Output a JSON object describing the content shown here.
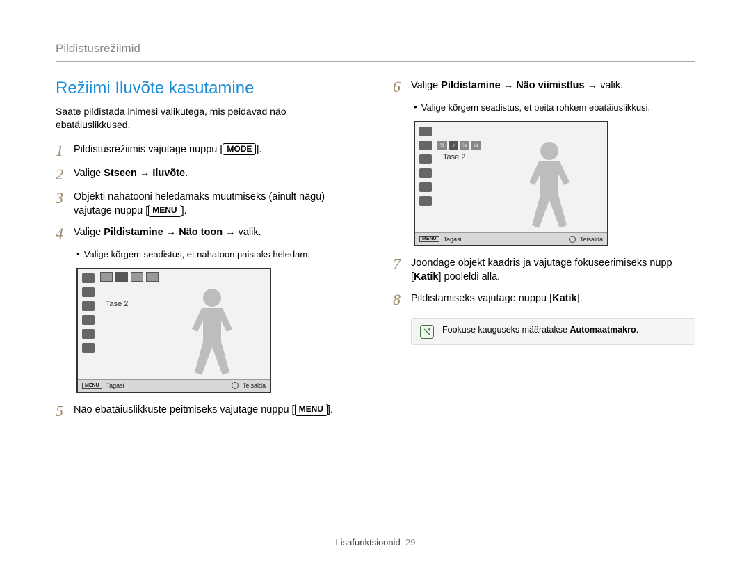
{
  "header": {
    "section": "Pildistusrežiimid"
  },
  "title": "Režiimi Iluvõte kasutamine",
  "intro": "Saate pildistada inimesi valikutega, mis peidavad näo ebatäiuslikkused.",
  "buttons": {
    "mode": "MODE",
    "menu": "MENU"
  },
  "steps_left": {
    "1": {
      "pre": "Pildistusrežiimis vajutage nuppu [",
      "btn": "mode",
      "post": "]."
    },
    "2": {
      "text_a": "Valige ",
      "bold": "Stseen → Iluvõte",
      "text_b": "."
    },
    "3": {
      "text_a": "Objekti nahatooni heledamaks muutmiseks (ainult nägu) vajutage nuppu [",
      "btn": "menu",
      "text_b": "]."
    },
    "4": {
      "text_a": "Valige ",
      "bold": "Pildistamine → Näo toon",
      "text_b": " → valik."
    },
    "4_bullet": "Valige kõrgem seadistus, et nahatoon paistaks heledam.",
    "5": {
      "text_a": "Näo ebatäiuslikkuste peitmiseks vajutage nuppu [",
      "btn": "menu",
      "text_b": "]."
    }
  },
  "steps_right": {
    "6": {
      "text_a": "Valige ",
      "bold": "Pildistamine → Näo viimistlus",
      "text_b": " → valik."
    },
    "6_bullet": "Valige kõrgem seadistus, et peita rohkem ebatäiuslikkusi.",
    "7": {
      "text_a": "Joondage objekt kaadris ja vajutage fokuseerimiseks nupp [",
      "bold": "Katik",
      "text_b": "] pooleldi alla."
    },
    "8": {
      "text_a": "Pildistamiseks vajutage nuppu [",
      "bold": "Katik",
      "text_b": "]."
    }
  },
  "camera": {
    "level_label": "Tase 2",
    "back": "Tagasi",
    "move": "Teisalda",
    "menu": "MENU"
  },
  "info": {
    "text_a": "Fookuse kauguseks määratakse ",
    "bold": "Automaatmakro",
    "text_b": "."
  },
  "footer": {
    "label": "Lisafunktsioonid",
    "page": "29"
  }
}
